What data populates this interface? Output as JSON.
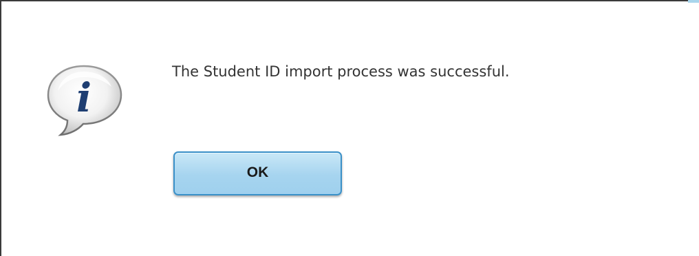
{
  "dialog": {
    "message": "The Student ID import process was successful.",
    "ok_label": "OK",
    "icon": "info-speech-bubble-icon",
    "icon_glyph": "i"
  },
  "colors": {
    "button_border": "#3a90c8",
    "button_fill": "#a6d4ef",
    "icon_glyph": "#1e3e72",
    "text": "#333333"
  }
}
